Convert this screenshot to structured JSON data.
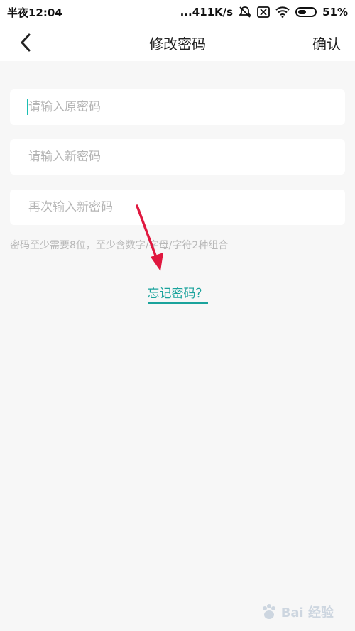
{
  "status_bar": {
    "time": "半夜12:04",
    "network_speed": "...411K/s",
    "battery_percent": "51%",
    "battery_level": 0.51
  },
  "app_bar": {
    "title": "修改密码",
    "confirm_label": "确认",
    "back_icon": "chevron-left-icon"
  },
  "form": {
    "old_password": {
      "placeholder": "请输入原密码",
      "value": ""
    },
    "new_password": {
      "placeholder": "请输入新密码",
      "value": ""
    },
    "confirm_password": {
      "placeholder": "再次输入新密码",
      "value": ""
    },
    "hint": "密码至少需要8位，至少含数字/字母/字符2种组合"
  },
  "forgot_password_label": "忘记密码？",
  "watermark": {
    "text": "Bai 经验"
  },
  "colors": {
    "accent": "#1aa39c",
    "annotation_arrow": "#e0183f",
    "background": "#f7f7f7"
  }
}
